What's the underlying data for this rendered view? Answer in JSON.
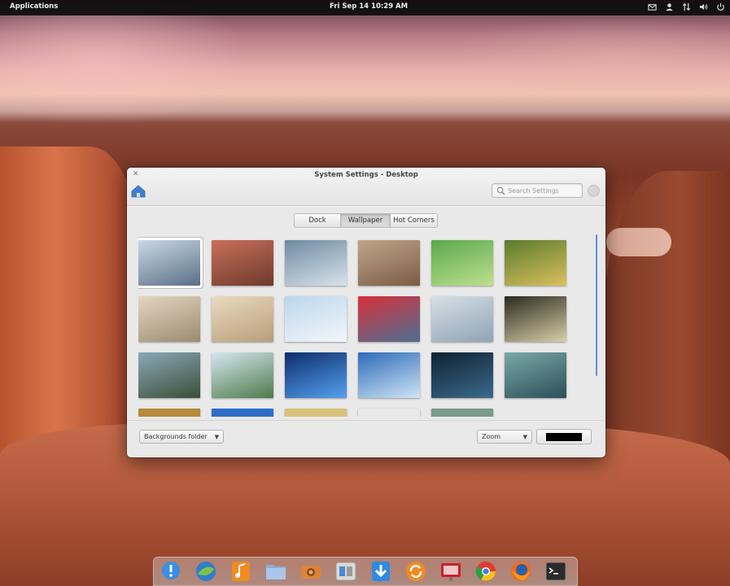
{
  "top_panel": {
    "applications_label": "Applications",
    "clock": "Fri Sep 14 10:29 AM",
    "tray_icons": [
      "mail-icon",
      "user-icon",
      "network-icon",
      "volume-icon",
      "power-icon"
    ]
  },
  "window": {
    "title": "System Settings - Desktop",
    "search_placeholder": "Search Settings",
    "tabs": [
      {
        "label": "Dock",
        "active": false
      },
      {
        "label": "Wallpaper",
        "active": true
      },
      {
        "label": "Hot Corners",
        "active": false
      }
    ],
    "wallpapers": {
      "selected_index": 0,
      "colors": [
        [
          "#c9d8e6",
          "#5b6f86"
        ],
        [
          "#c9705b",
          "#6e3a2c"
        ],
        [
          "#6f8aa0",
          "#d7e2ea"
        ],
        [
          "#c2a48a",
          "#7b5b45"
        ],
        [
          "#59a84d",
          "#bfe08e"
        ],
        [
          "#5b7a2e",
          "#d9c05c"
        ],
        [
          "#e4d6c1",
          "#9a8a70"
        ],
        [
          "#e9dac0",
          "#b89e78"
        ],
        [
          "#bcd6ec",
          "#f2f6fa"
        ],
        [
          "#d8303a",
          "#4c6f93"
        ],
        [
          "#d7dfe6",
          "#8fa3b4"
        ],
        [
          "#2c2a1f",
          "#d6cfa8"
        ],
        [
          "#8aa8b8",
          "#3a4e38"
        ],
        [
          "#d6e6f0",
          "#4e7a4b"
        ],
        [
          "#0d2d6a",
          "#54a0f0"
        ],
        [
          "#2d6ab8",
          "#cfe4f6"
        ],
        [
          "#0f2233",
          "#3b6a8c"
        ],
        [
          "#79a8a8",
          "#2b4f57"
        ]
      ],
      "partial_row_colors": [
        "#b58a3a",
        "#2c6ec8",
        "#d8c27a",
        "#e8e8e8",
        "#7a9a8a"
      ]
    },
    "backgrounds_folder": "Backgrounds folder",
    "zoom_mode": "Zoom",
    "background_color": "#000000"
  },
  "dock": {
    "items": [
      "messages-icon",
      "browser-midori-icon",
      "music-icon",
      "files-icon",
      "photos-icon",
      "switchboard-icon",
      "software-download-icon",
      "update-icon",
      "presentation-icon",
      "chrome-icon",
      "firefox-icon",
      "terminal-icon"
    ]
  }
}
